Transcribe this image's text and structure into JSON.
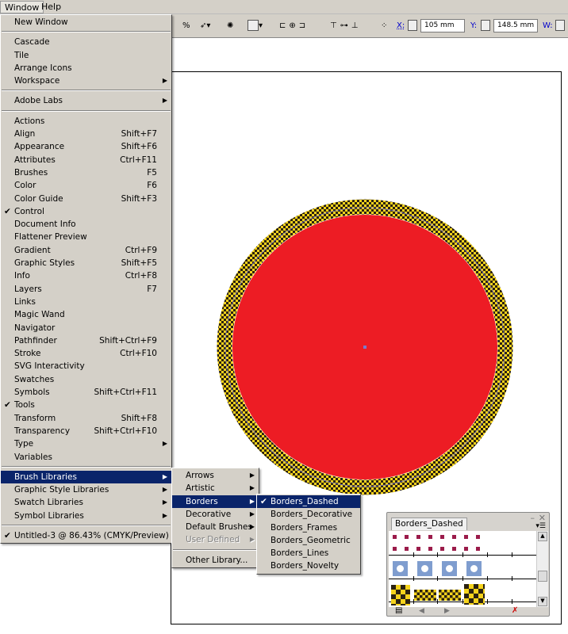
{
  "menubar": {
    "items": [
      "Window",
      "Help"
    ]
  },
  "toolbar": {
    "percent": "%",
    "x_label": "X:",
    "x_value": "105 mm",
    "y_label": "Y:",
    "y_value": "148.5 mm",
    "w_label": "W:"
  },
  "window_menu": [
    {
      "label": "New Window"
    },
    {
      "sep": true
    },
    {
      "label": "Cascade"
    },
    {
      "label": "Tile"
    },
    {
      "label": "Arrange Icons"
    },
    {
      "label": "Workspace",
      "sub": true
    },
    {
      "sep": true
    },
    {
      "label": "Adobe Labs",
      "sub": true
    },
    {
      "sep": true
    },
    {
      "label": "Actions"
    },
    {
      "label": "Align",
      "shortcut": "Shift+F7"
    },
    {
      "label": "Appearance",
      "shortcut": "Shift+F6"
    },
    {
      "label": "Attributes",
      "shortcut": "Ctrl+F11"
    },
    {
      "label": "Brushes",
      "shortcut": "F5"
    },
    {
      "label": "Color",
      "shortcut": "F6"
    },
    {
      "label": "Color Guide",
      "shortcut": "Shift+F3"
    },
    {
      "label": "Control",
      "checked": true
    },
    {
      "label": "Document Info"
    },
    {
      "label": "Flattener Preview"
    },
    {
      "label": "Gradient",
      "shortcut": "Ctrl+F9"
    },
    {
      "label": "Graphic Styles",
      "shortcut": "Shift+F5"
    },
    {
      "label": "Info",
      "shortcut": "Ctrl+F8"
    },
    {
      "label": "Layers",
      "shortcut": "F7"
    },
    {
      "label": "Links"
    },
    {
      "label": "Magic Wand"
    },
    {
      "label": "Navigator"
    },
    {
      "label": "Pathfinder",
      "shortcut": "Shift+Ctrl+F9"
    },
    {
      "label": "Stroke",
      "shortcut": "Ctrl+F10"
    },
    {
      "label": "SVG Interactivity"
    },
    {
      "label": "Swatches"
    },
    {
      "label": "Symbols",
      "shortcut": "Shift+Ctrl+F11"
    },
    {
      "label": "Tools",
      "checked": true
    },
    {
      "label": "Transform",
      "shortcut": "Shift+F8"
    },
    {
      "label": "Transparency",
      "shortcut": "Shift+Ctrl+F10"
    },
    {
      "label": "Type",
      "sub": true
    },
    {
      "label": "Variables"
    },
    {
      "sep": true
    },
    {
      "label": "Brush Libraries",
      "sub": true,
      "highlighted": true
    },
    {
      "label": "Graphic Style Libraries",
      "sub": true
    },
    {
      "label": "Swatch Libraries",
      "sub": true
    },
    {
      "label": "Symbol Libraries",
      "sub": true
    },
    {
      "sep": true
    },
    {
      "label": "Untitled-3 @ 86.43% (CMYK/Preview)",
      "checked": true
    }
  ],
  "brush_libraries_menu": [
    {
      "label": "Arrows",
      "sub": true
    },
    {
      "label": "Artistic",
      "sub": true
    },
    {
      "label": "Borders",
      "sub": true,
      "highlighted": true
    },
    {
      "label": "Decorative",
      "sub": true
    },
    {
      "label": "Default Brushes",
      "sub": true
    },
    {
      "label": "User Defined",
      "sub": true,
      "disabled": true
    },
    {
      "sep": true
    },
    {
      "label": "Other Library..."
    }
  ],
  "borders_menu": [
    {
      "label": "Borders_Dashed",
      "checked": true,
      "highlighted": true
    },
    {
      "label": "Borders_Decorative"
    },
    {
      "label": "Borders_Frames"
    },
    {
      "label": "Borders_Geometric"
    },
    {
      "label": "Borders_Lines"
    },
    {
      "label": "Borders_Novelty"
    }
  ],
  "panel": {
    "tab": "Borders_Dashed",
    "close": "×"
  },
  "colors": {
    "highlight": "#0a246a",
    "circle_fill": "#ed1c24",
    "border_yellow": "#f5d31c",
    "border_dark": "#2b2211",
    "square_red": "#9b1b4a",
    "square_blue": "#7f9dcf"
  }
}
